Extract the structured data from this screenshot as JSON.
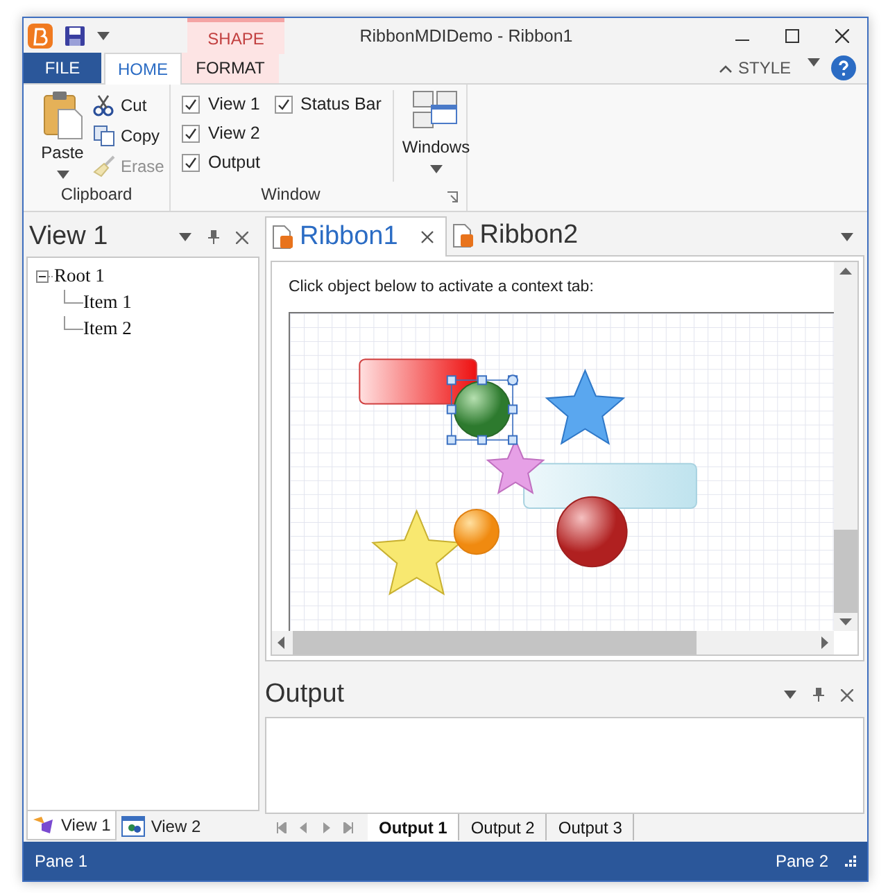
{
  "window": {
    "title": "RibbonMDIDemo - Ribbon1"
  },
  "context_tab_group": {
    "label": "SHAPE"
  },
  "ribbon_tabs": [
    {
      "label": "FILE",
      "kind": "file",
      "selected": false
    },
    {
      "label": "HOME",
      "kind": "normal",
      "selected": true
    },
    {
      "label": "FORMAT",
      "kind": "context",
      "selected": false
    }
  ],
  "style_menu": {
    "label": "STYLE"
  },
  "clipboard_group": {
    "label": "Clipboard",
    "paste": "Paste",
    "items": [
      {
        "label": "Cut",
        "kind": "cut",
        "disabled": false
      },
      {
        "label": "Copy",
        "kind": "copy",
        "disabled": false
      },
      {
        "label": "Erase",
        "kind": "erase",
        "disabled": true
      }
    ]
  },
  "window_group": {
    "label": "Window",
    "checkboxes": [
      {
        "label": "View 1",
        "checked": true
      },
      {
        "label": "View 2",
        "checked": true
      },
      {
        "label": "Output",
        "checked": true
      },
      {
        "label": "Status Bar",
        "checked": true
      }
    ],
    "windows_button": "Windows"
  },
  "left_pane": {
    "title": "View 1",
    "tree": [
      {
        "label": "Root 1",
        "expanded": true,
        "children": [
          {
            "label": "Item 1"
          },
          {
            "label": "Item 2"
          }
        ]
      }
    ],
    "tabs": [
      {
        "label": "View 1",
        "selected": true
      },
      {
        "label": "View 2",
        "selected": false
      }
    ]
  },
  "document_tabs": [
    {
      "label": "Ribbon1",
      "selected": true
    },
    {
      "label": "Ribbon2",
      "selected": false
    }
  ],
  "document": {
    "instruction": "Click object below to activate a context tab:"
  },
  "output_pane": {
    "title": "Output",
    "tabs": [
      {
        "label": "Output 1",
        "selected": true
      },
      {
        "label": "Output 2",
        "selected": false
      },
      {
        "label": "Output 3",
        "selected": false
      }
    ]
  },
  "status_bar": {
    "left": "Pane 1",
    "right": "Pane 2"
  }
}
